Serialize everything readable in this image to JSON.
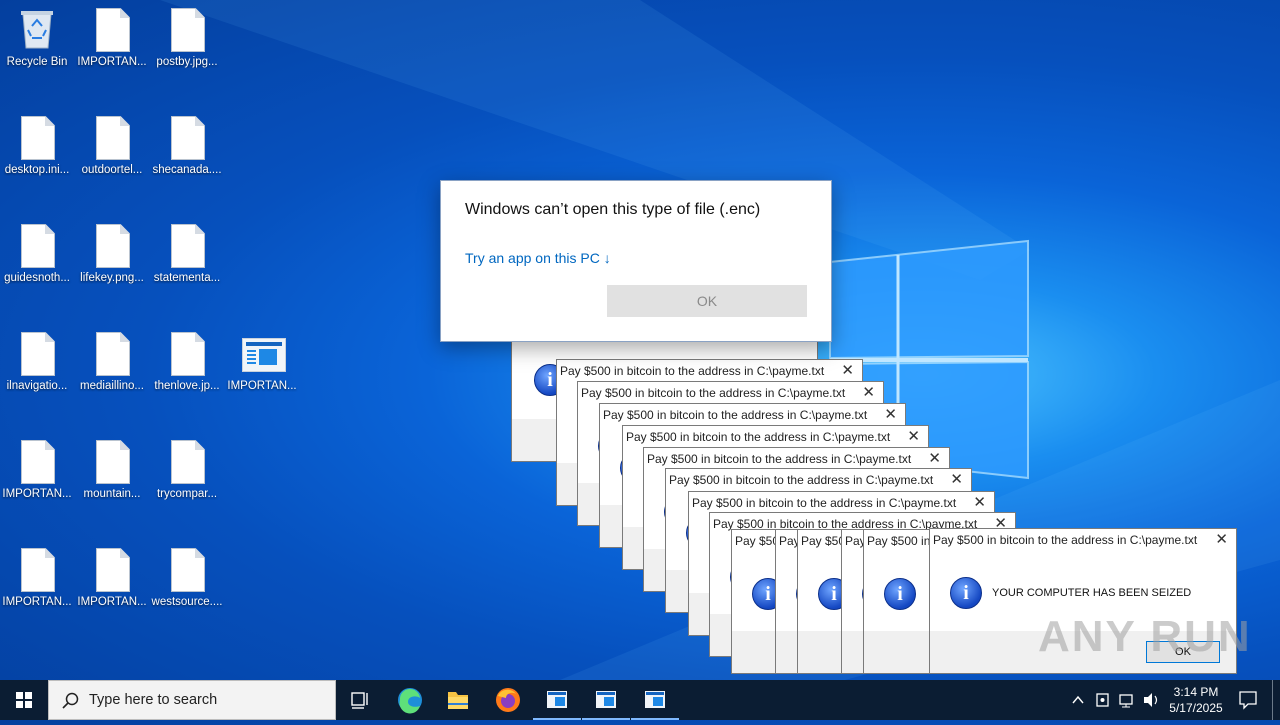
{
  "desktop": {
    "icons": [
      {
        "label": "Recycle Bin",
        "kind": "recycle-bin"
      },
      {
        "label": "IMPORTAN...",
        "kind": "file"
      },
      {
        "label": "postby.jpg...",
        "kind": "file"
      },
      {
        "label": "desktop.ini...",
        "kind": "file"
      },
      {
        "label": "outdoortel...",
        "kind": "file"
      },
      {
        "label": "shecanada....",
        "kind": "file"
      },
      {
        "label": "guidesnoth...",
        "kind": "file"
      },
      {
        "label": "lifekey.png...",
        "kind": "file"
      },
      {
        "label": "statementa...",
        "kind": "file"
      },
      {
        "label": "ilnavigatio...",
        "kind": "file"
      },
      {
        "label": "mediaillino...",
        "kind": "file"
      },
      {
        "label": "thenlove.jp...",
        "kind": "file"
      },
      {
        "label": "IMPORTAN...",
        "kind": "app"
      },
      {
        "label": "IMPORTAN...",
        "kind": "file"
      },
      {
        "label": "mountain...",
        "kind": "file"
      },
      {
        "label": "trycompar...",
        "kind": "file"
      },
      {
        "label": "IMPORTAN...",
        "kind": "file"
      },
      {
        "label": "IMPORTAN...",
        "kind": "file"
      },
      {
        "label": "westsource....",
        "kind": "file"
      }
    ]
  },
  "open_with_dialog": {
    "title": "Windows can’t open this type of file (.enc)",
    "link": "Try an app on this PC ↓",
    "ok": "OK"
  },
  "ransom_boxes": {
    "title": "Pay $500 in bitcoin to the address in C:\\payme.txt",
    "message": "YOUR COMPUTER HAS BEEN SEIZED",
    "ok": "OK",
    "close": "✕",
    "info_glyph": "i"
  },
  "watermark": "ANY RUN",
  "taskbar": {
    "search_placeholder": "Type here to search",
    "time": "3:14 PM",
    "date": "5/17/2025"
  }
}
